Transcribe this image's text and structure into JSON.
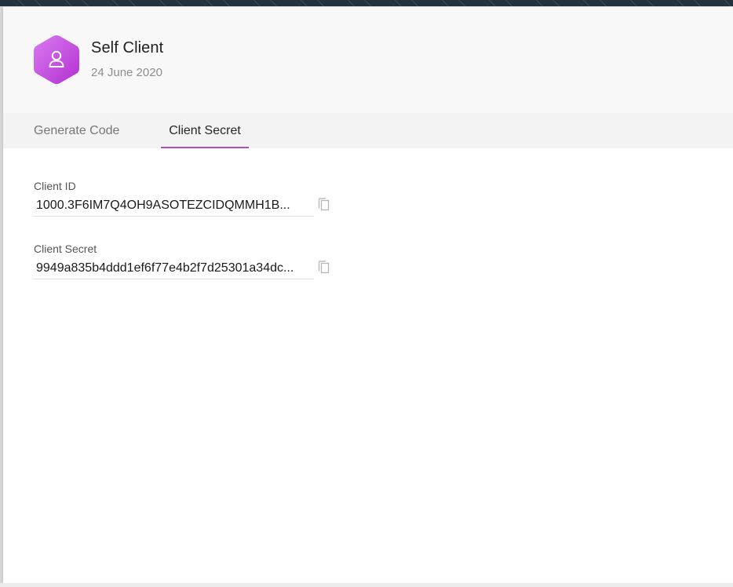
{
  "client": {
    "name": "Self Client",
    "date": "24 June 2020"
  },
  "tabs": [
    {
      "label": "Generate Code",
      "active": false
    },
    {
      "label": "Client Secret",
      "active": true
    }
  ],
  "fields": {
    "client_id": {
      "label": "Client ID",
      "value": "1000.3F6IM7Q4OH9ASOTEZCIDQMMH1B..."
    },
    "client_secret": {
      "label": "Client Secret",
      "value": "9949a835b4ddd1ef6f77e4b2f7d25301a34dc..."
    }
  },
  "icons": {
    "avatar": "user-icon",
    "copy": "copy-icon"
  },
  "colors": {
    "accent": "#b44ac7",
    "avatar_gradient_start": "#da7cf0",
    "avatar_gradient_end": "#b22fd1"
  }
}
